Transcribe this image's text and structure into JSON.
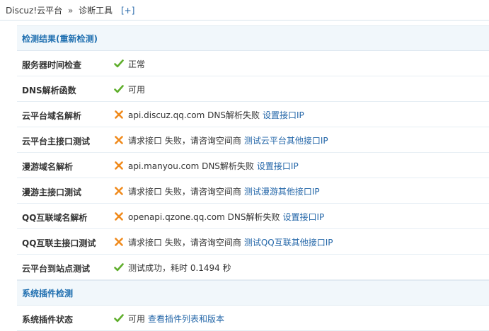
{
  "breadcrumb": {
    "root": "Discuz!云平台",
    "separator": "»",
    "current": "诊断工具",
    "expand": "[+]"
  },
  "sections": [
    {
      "title": "检测结果(重新检测)",
      "rows": [
        {
          "label": "服务器时间检查",
          "status": "ok",
          "text": "正常",
          "link": ""
        },
        {
          "label": "DNS解析函数",
          "status": "ok",
          "text": "可用",
          "link": ""
        },
        {
          "label": "云平台域名解析",
          "status": "fail",
          "text": "api.discuz.qq.com DNS解析失败",
          "link": "设置接口IP"
        },
        {
          "label": "云平台主接口测试",
          "status": "fail",
          "text": "请求接口 失败，请咨询空间商",
          "link": "测试云平台其他接口IP"
        },
        {
          "label": "漫游域名解析",
          "status": "fail",
          "text": "api.manyou.com DNS解析失败",
          "link": "设置接口IP"
        },
        {
          "label": "漫游主接口测试",
          "status": "fail",
          "text": "请求接口 失败，请咨询空间商",
          "link": "测试漫游其他接口IP"
        },
        {
          "label": "QQ互联域名解析",
          "status": "fail",
          "text": "openapi.qzone.qq.com DNS解析失败",
          "link": "设置接口IP"
        },
        {
          "label": "QQ互联主接口测试",
          "status": "fail",
          "text": "请求接口 失败，请咨询空间商",
          "link": "测试QQ互联其他接口IP"
        },
        {
          "label": "云平台到站点测试",
          "status": "ok",
          "text": "测试成功，耗时 0.1494 秒",
          "link": ""
        }
      ]
    },
    {
      "title": "系统插件检测",
      "rows": [
        {
          "label": "系统插件状态",
          "status": "ok",
          "text": "可用",
          "link": "查看插件列表和版本"
        }
      ]
    }
  ],
  "icons": {
    "ok": "check-icon",
    "fail": "cross-icon"
  },
  "colors": {
    "ok": "#5fae2c",
    "fail": "#f08a1c",
    "link": "#2366a8",
    "section_title": "#1f6fb0"
  }
}
